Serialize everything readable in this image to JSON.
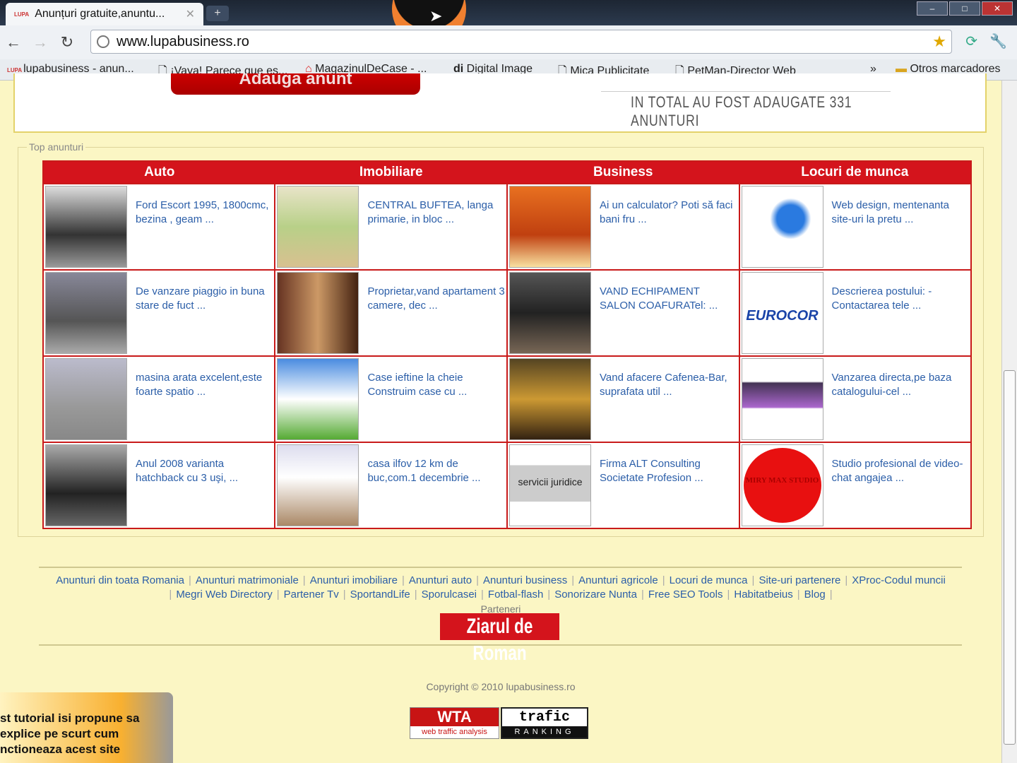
{
  "browser": {
    "tab_title": "Anunțuri gratuite,anuntu...",
    "tab_favicon": "LUPA",
    "url": "www.lupabusiness.ro",
    "bookmarks": [
      "lupabusiness - anun...",
      "¡Vaya! Parece que es...",
      "MagazinulDeCase - ...",
      "Digital Image",
      "Mica Publicitate",
      "PetMan-Director Web"
    ],
    "more": "»",
    "other_bookmarks": "Otros marcadores"
  },
  "header": {
    "add_button": "Adauga anunt",
    "total_text": "IN TOTAL AU FOST ADAUGATE 331 ANUNTURI"
  },
  "top": {
    "legend": "Top anunturi",
    "columns": [
      "Auto",
      "Imobiliare",
      "Business",
      "Locuri de munca"
    ],
    "rows": [
      [
        "Ford Escort 1995, 1800cmc, bezina , geam ...",
        "CENTRAL BUFTEA, langa primarie, in bloc ...",
        "Ai un calculator? Poti să faci bani fru ...",
        "Web design, mentenanta site-uri la pretu ..."
      ],
      [
        "De vanzare piaggio in buna stare de fuct ...",
        "Proprietar,vand apartament 3 camere, dec ...",
        "VAND ECHIPAMENT SALON COAFURATel: ...",
        "Descrierea postului: - Contactarea tele ..."
      ],
      [
        "masina arata excelent,este foarte spatio ...",
        "Case ieftine la cheie Construim case cu ...",
        "Vand afacere Cafenea-Bar, suprafata util ...",
        "Vanzarea directa,pe baza catalogului-cel ..."
      ],
      [
        "Anul 2008 varianta hatchback cu 3 uşi, ...",
        "casa ilfov 12 km de buc,com.1 decembrie ...",
        "Firma ALT Consulting Societate Profesion ...",
        "Studio profesional de video-chat angajea ..."
      ]
    ],
    "image_labels": {
      "eurocor": "EUROCOR",
      "servicii": "servicii juridice",
      "studio": "MIRY MAX STUDIO"
    }
  },
  "footer": {
    "links1": [
      "Anunturi din toata Romania",
      "Anunturi matrimoniale",
      "Anunturi imobiliare",
      "Anunturi auto",
      "Anunturi business",
      "Anunturi agricole",
      "Locuri de munca",
      "Site-uri partenere",
      "XProc-Codul muncii"
    ],
    "links2": [
      "Megri Web Directory",
      "Partener Tv",
      "SportandLife",
      "Sporulcasei",
      "Fotbal-flash",
      "Sonorizare Nunta",
      "Free SEO Tools",
      "Habitatbeius",
      "Blog"
    ],
    "partners_label": "Parteneri",
    "ziar": "Ziarul de Roman",
    "copyright": "Copyright © 2010 lupabusiness.ro",
    "wta": "WTA",
    "wta_sub": "web traffic analysis",
    "trafic": "trafic",
    "trafic_sub": "RANKING"
  },
  "caption": [
    "st tutorial isi propune sa",
    "explice pe scurt cum",
    "nctioneaza acest site"
  ]
}
